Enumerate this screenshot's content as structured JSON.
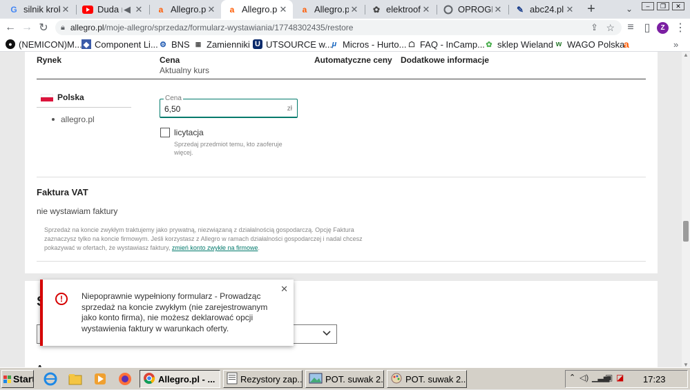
{
  "browser": {
    "tabs": [
      {
        "label": "silnik krok",
        "icon": "google-icon"
      },
      {
        "label": "Duda re",
        "icon": "youtube-icon"
      },
      {
        "label": "Allegro.pl",
        "icon": "allegro-icon"
      },
      {
        "label": "Allegro.pl",
        "icon": "allegro-icon"
      },
      {
        "label": "Allegro.pl",
        "icon": "allegro-icon"
      },
      {
        "label": "elektroofer",
        "icon": "elektro-icon"
      },
      {
        "label": "OPROGRAM",
        "icon": "web-icon"
      },
      {
        "label": "abc24.pl",
        "icon": "abc-icon"
      }
    ],
    "url": "allegro.pl/moje-allegro/sprzedaz/formularz-wystawiania/17748302435/restore",
    "url_domain": "allegro.pl",
    "url_path": "/moje-allegro/sprzedaz/formularz-wystawiania/17748302435/restore",
    "profile_initial": "Z",
    "bookmarks": [
      {
        "label": "(NEMICON)M..."
      },
      {
        "label": "Component Li..."
      },
      {
        "label": "BNS"
      },
      {
        "label": "Zamienniki"
      },
      {
        "label": "UTSOURCE w..."
      },
      {
        "label": "Micros - Hurto..."
      },
      {
        "label": "FAQ - InCamp..."
      },
      {
        "label": "sklep Wieland"
      },
      {
        "label": "WAGO Polska"
      },
      {
        "label": "a"
      }
    ]
  },
  "pricing": {
    "col_market": "Rynek",
    "col_price": "Cena",
    "col_price_sub": "Aktualny kurs",
    "col_auto": "Automatyczne ceny",
    "col_info": "Dodatkowe informacje",
    "market_name": "Polska",
    "market_site": "allegro.pl",
    "price_label": "Cena",
    "price_value": "6,50",
    "price_currency": "zł",
    "auction_label": "licytacja",
    "auction_help": "Sprzedaj przedmiot temu, kto zaoferuje więcej."
  },
  "invoice": {
    "title": "Faktura VAT",
    "value": "nie wystawiam faktury",
    "note_text": "Sprzedaż na koncie zwykłym traktujemy jako prywatną, niezwiązaną z działalnością gospodarczą. Opcję Faktura zaznaczysz tylko na koncie firmowym. Jeśli korzystasz z Allegro w ramach działalności gospodarczej i nadal chcesz pokazywać w ofertach, że wystawiasz faktury,",
    "note_link": "zmień konto zwykłe na firmowe",
    "note_end": "."
  },
  "next_section": {
    "title_fragment": "S",
    "bottom_fragment": "A"
  },
  "toast": {
    "message": "Niepoprawnie wypełniony formularz - Prowadząc sprzedaż na koncie zwykłym (nie zarejestrowanym jako konto firma), nie możesz deklarować opcji wystawienia faktury w warunkach oferty."
  },
  "taskbar": {
    "start_label": "Start",
    "windows": [
      {
        "label": "Allegro.pl - ..."
      },
      {
        "label": "Rezystory zap..."
      },
      {
        "label": "POT. suwak 2..."
      },
      {
        "label": "POT. suwak 2..."
      }
    ],
    "clock": "17:23"
  },
  "colors": {
    "accent_teal": "#00796b",
    "error_red": "#d50000",
    "flag_red": "#dc143c",
    "allegro_orange": "#ff5a00"
  }
}
